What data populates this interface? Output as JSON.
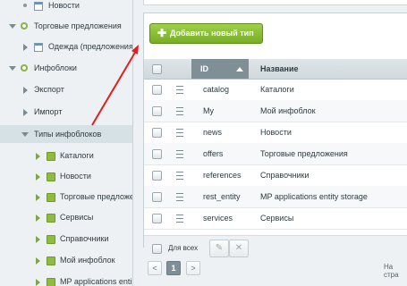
{
  "sidebar": {
    "items": [
      {
        "label": "Новости"
      },
      {
        "label": "Торговые предложения"
      },
      {
        "label": "Одежда (предложения)"
      },
      {
        "label": "Инфоблоки"
      },
      {
        "label": "Экспорт"
      },
      {
        "label": "Импорт"
      },
      {
        "label": "Типы инфоблоков"
      },
      {
        "label": "Каталоги"
      },
      {
        "label": "Новости"
      },
      {
        "label": "Торговые предложе"
      },
      {
        "label": "Сервисы"
      },
      {
        "label": "Справочники"
      },
      {
        "label": "Мой инфоблок"
      },
      {
        "label": "MP applications enti"
      }
    ]
  },
  "toolbar": {
    "add_label": "Добавить новый тип",
    "add_icon": "plus-icon"
  },
  "grid": {
    "headers": {
      "id": "ID",
      "name": "Название"
    },
    "rows": [
      {
        "id": "catalog",
        "name": "Каталоги"
      },
      {
        "id": "My",
        "name": "Мой инфоблок"
      },
      {
        "id": "news",
        "name": "Новости"
      },
      {
        "id": "offers",
        "name": "Торговые предложения"
      },
      {
        "id": "references",
        "name": "Справочники"
      },
      {
        "id": "rest_entity",
        "name": "MP applications entity storage"
      },
      {
        "id": "services",
        "name": "Сервисы"
      }
    ],
    "footer": {
      "all_label": "Для всех",
      "edit_icon": "pencil-icon",
      "delete_icon": "close-icon"
    }
  },
  "pager": {
    "prev": "<",
    "current": "1",
    "next": ">",
    "right_text": "На стра"
  },
  "colors": {
    "accent": "#7fb131",
    "header_active": "#7e8f96",
    "annotation": "#e02020"
  }
}
